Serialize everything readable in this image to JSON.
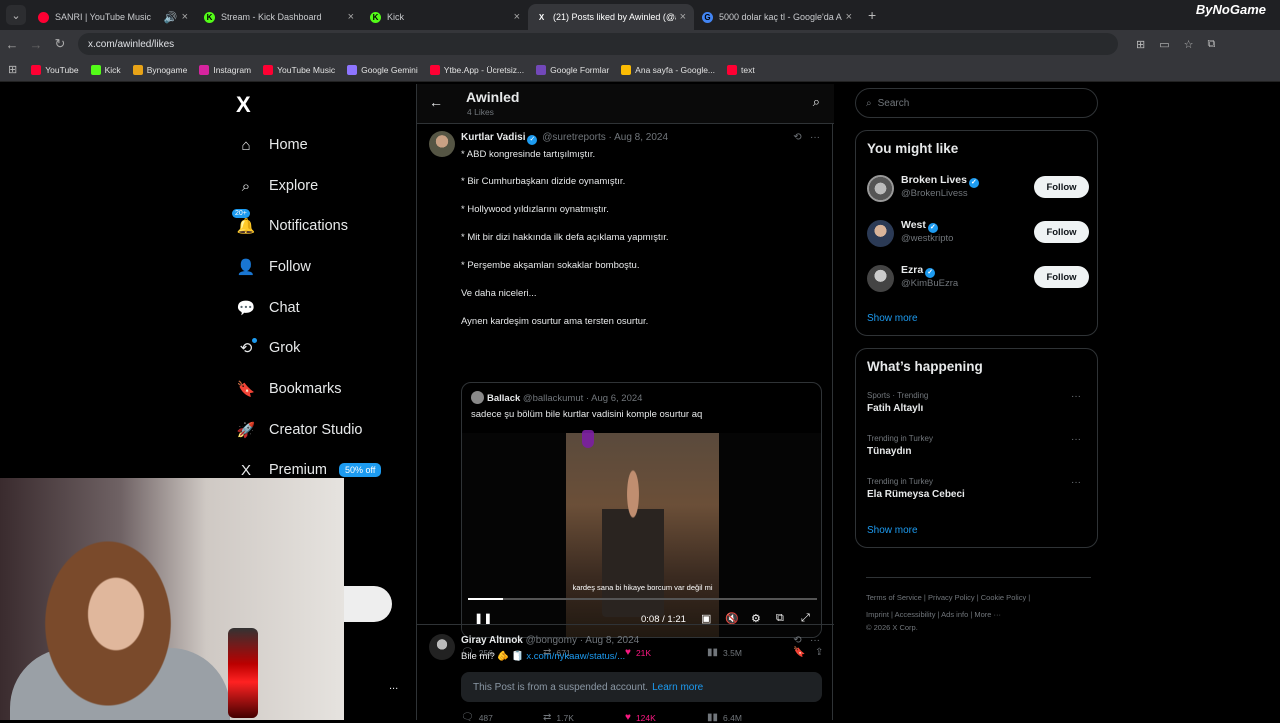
{
  "browser": {
    "tabs": [
      {
        "title": "SANRI | YouTube Music",
        "color": "#ff0033",
        "mark": "",
        "active": false
      },
      {
        "title": "Stream - Kick Dashboard",
        "color": "#53fc18",
        "mark": "K",
        "active": false
      },
      {
        "title": "Kick",
        "color": "#53fc18",
        "mark": "K",
        "active": false
      },
      {
        "title": "(21) Posts liked by Awinled (@a",
        "color": "#ffffff",
        "mark": "X",
        "active": true
      },
      {
        "title": "5000 dolar kaç tl - Google'da A",
        "color": "#4285f4",
        "mark": "G",
        "active": false
      }
    ],
    "brand": "ByNoGame",
    "url": "x.com/awinled/likes",
    "bookmarks": [
      {
        "label": "YouTube",
        "color": "#ff0033"
      },
      {
        "label": "Kick",
        "color": "#53fc18"
      },
      {
        "label": "Bynogame",
        "color": "#e8a317"
      },
      {
        "label": "Instagram",
        "color": "#d6249f"
      },
      {
        "label": "YouTube Music",
        "color": "#ff0033"
      },
      {
        "label": "Google Gemini",
        "color": "#8e75ff"
      },
      {
        "label": "Ytbe.App - Ücretsiz...",
        "color": "#ff0033"
      },
      {
        "label": "Google Formlar",
        "color": "#7248b9"
      },
      {
        "label": "Ana sayfa - Google...",
        "color": "#fbbc04"
      },
      {
        "label": "text",
        "color": "#ff0033"
      }
    ]
  },
  "sidebar": {
    "logo": "X",
    "items": [
      {
        "label": "Home",
        "icon": "home-icon"
      },
      {
        "label": "Explore",
        "icon": "search-icon"
      },
      {
        "label": "Notifications",
        "icon": "bell-icon",
        "badge": "20+"
      },
      {
        "label": "Follow",
        "icon": "person-add-icon"
      },
      {
        "label": "Chat",
        "icon": "chat-icon"
      },
      {
        "label": "Grok",
        "icon": "grok-icon"
      },
      {
        "label": "Bookmarks",
        "icon": "bookmark-icon"
      },
      {
        "label": "Creator Studio",
        "icon": "rocket-icon"
      },
      {
        "label": "Premium",
        "icon": "x-icon",
        "badge": "50% off"
      }
    ],
    "more": "..."
  },
  "profile_header": {
    "name": "Awinled",
    "subtitle": "4 Likes"
  },
  "post1": {
    "author": "Kurtlar Vadisi",
    "handle": "@suretreports",
    "date": "· Aug 8, 2024",
    "lines": [
      "* ABD kongresinde tartışılmıştır.",
      "* Bir Cumhurbaşkanı dizide oynamıştır.",
      "* Hollywood yıldızlarını oynatmıştır.",
      "* Mit bir dizi hakkında ilk defa açıklama yapmıştır.",
      "* Perşembe akşamları sokaklar bomboştu.",
      "Ve daha niceleri...",
      "Aynen kardeşim osurtur ama tersten osurtur."
    ],
    "quote": {
      "author": "Ballack",
      "handle": "@ballackumut",
      "date": "· Aug 6, 2024",
      "text": "sadece şu bölüm bile kurtlar vadisini komple osurtur aq",
      "caption": "kardeş sana bi hikaye borcum var değil mi",
      "time": "0:08 / 1:21",
      "progress": 0.1
    },
    "stats": {
      "replies": "256",
      "reposts": "671",
      "likes": "21K",
      "views": "3.5M"
    }
  },
  "post2": {
    "author": "Giray Altınok",
    "handle": "@bongomy",
    "date": "· Aug 8, 2024",
    "text": "Bile mi? 🫵 🧻",
    "link": "x.com/nykaaw/status/...",
    "suspended": "This Post is from a suspended account.",
    "learn_more": "Learn more",
    "stats": {
      "replies": "487",
      "reposts": "1.7K",
      "likes": "124K",
      "views": "6.4M"
    }
  },
  "right": {
    "search_placeholder": "Search",
    "might_like": {
      "title": "You might like",
      "people": [
        {
          "name": "Broken Lives",
          "handle": "@BrokenLivess",
          "button": "Follow"
        },
        {
          "name": "West",
          "handle": "@westkripto",
          "button": "Follow"
        },
        {
          "name": "Ezra",
          "handle": "@KimBuEzra",
          "button": "Follow"
        }
      ],
      "show_more": "Show more"
    },
    "happening": {
      "title": "What’s happening",
      "trends": [
        {
          "context": "Sports · Trending",
          "name": "Fatih Altaylı"
        },
        {
          "context": "Trending in Turkey",
          "name": "Tünaydın"
        },
        {
          "context": "Trending in Turkey",
          "name": "Ela Rümeysa Cebeci"
        }
      ],
      "show_more": "Show more"
    },
    "footer_line1": "Terms of Service  |  Privacy Policy  |  Cookie Policy  |",
    "footer_line2": "Imprint  |  Accessibility  |  Ads info  |  More ···",
    "footer_line3": "© 2026 X Corp."
  }
}
